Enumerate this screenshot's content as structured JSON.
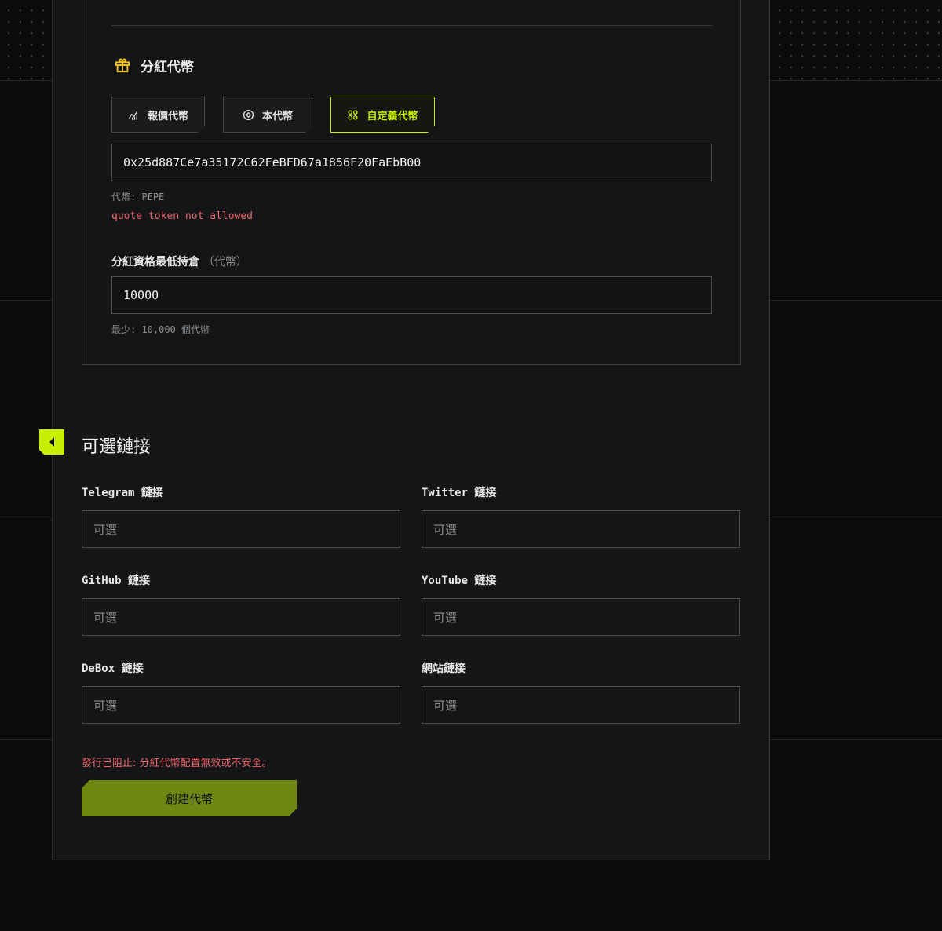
{
  "dividend": {
    "section_title": "分紅代幣",
    "tabs": [
      {
        "label": "報價代幣",
        "icon": "trend-chart-icon",
        "active": false
      },
      {
        "label": "本代幣",
        "icon": "target-icon",
        "active": false
      },
      {
        "label": "自定義代幣",
        "icon": "grid-icon",
        "active": true
      }
    ],
    "token_address": "0x25d887Ce7a35172C62FeBFD67a1856F20FaEbB00",
    "token_info": "代幣: PEPE",
    "token_error": "quote token not allowed",
    "min_hold_label": "分紅資格最低持倉",
    "min_hold_unit": "（代幣）",
    "min_hold_value": "10000",
    "min_hold_hint": "最少: 10,000 個代幣"
  },
  "links": {
    "section_title": "可選鏈接",
    "placeholder": "可選",
    "fields": [
      {
        "label": "Telegram 鏈接"
      },
      {
        "label": "Twitter 鏈接"
      },
      {
        "label": "GitHub 鏈接"
      },
      {
        "label": "YouTube 鏈接"
      },
      {
        "label": "DeBox 鏈接"
      },
      {
        "label": "網站鏈接"
      }
    ]
  },
  "launch": {
    "blocked_message": "發行已阻止: 分紅代幣配置無效或不安全。",
    "create_button": "創建代幣"
  },
  "colors": {
    "accent": "#c7f000",
    "error": "#f0646a",
    "button_bg": "#6f8712",
    "gift_icon": "#f5c623"
  }
}
